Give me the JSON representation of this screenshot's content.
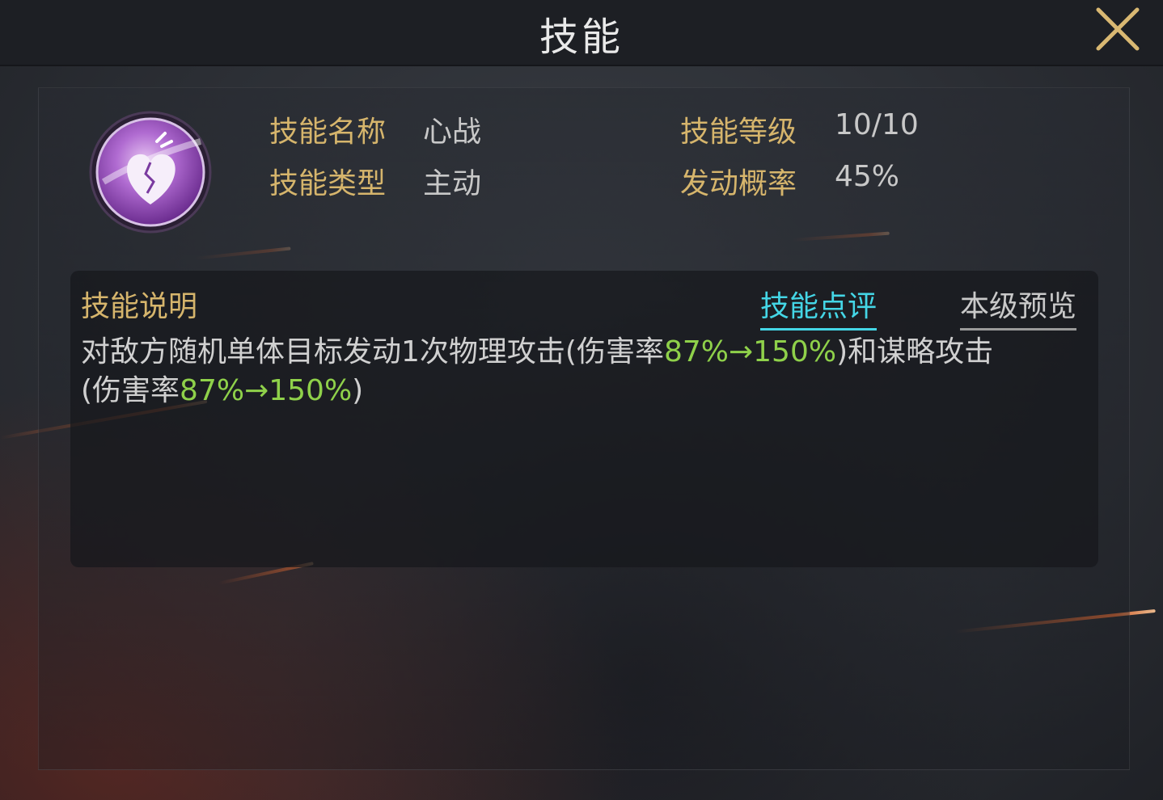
{
  "title": "技能",
  "skill": {
    "icon": "broken-heart-icon",
    "name_label": "技能名称",
    "name_value": "心战",
    "type_label": "技能类型",
    "type_value": "主动",
    "level_label": "技能等级",
    "level_value": "10/10",
    "chance_label": "发动概率",
    "chance_value": "45%"
  },
  "description": {
    "header": "技能说明",
    "tabs": [
      {
        "label": "技能点评",
        "active": true
      },
      {
        "label": "本级预览",
        "active": false
      }
    ],
    "text_parts": [
      "对敌方随机单体目标发动1次物理攻击(伤害率",
      "87%→150%",
      ")和谋略攻击",
      "(伤害率",
      "87%→150%",
      ")"
    ]
  },
  "colors": {
    "gold": "#d6b56c",
    "cyan": "#44d6e6",
    "green": "#8fd14a",
    "purple": "#9a4fc2"
  }
}
